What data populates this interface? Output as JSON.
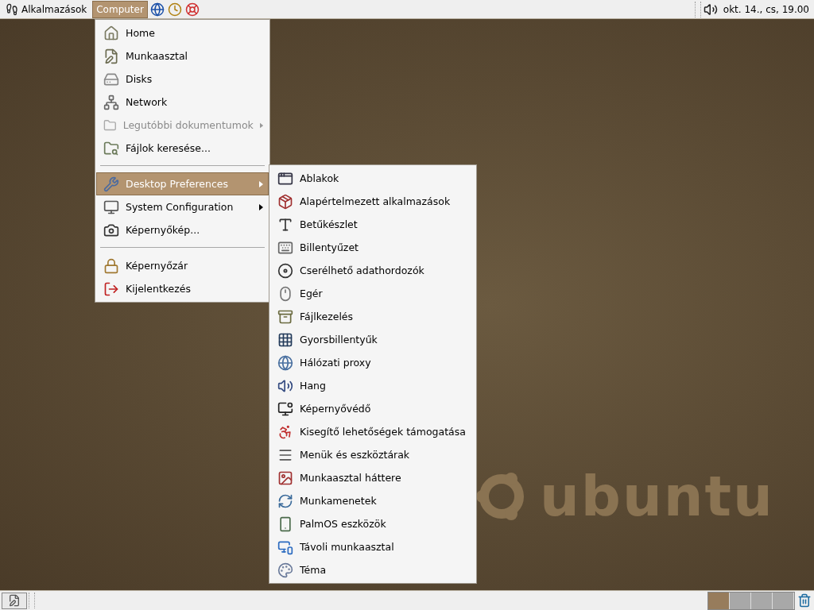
{
  "top_panel": {
    "menus": [
      {
        "label": "Alkalmazások",
        "selected": false
      },
      {
        "label": "Computer",
        "selected": true
      }
    ],
    "clock": "okt. 14., cs, 19.00"
  },
  "computer_menu": [
    {
      "kind": "item",
      "label": "Home",
      "disabled": false,
      "submenu": false,
      "selected": false
    },
    {
      "kind": "item",
      "label": "Munkaasztal",
      "disabled": false,
      "submenu": false,
      "selected": false
    },
    {
      "kind": "item",
      "label": "Disks",
      "disabled": false,
      "submenu": false,
      "selected": false
    },
    {
      "kind": "item",
      "label": "Network",
      "disabled": false,
      "submenu": false,
      "selected": false
    },
    {
      "kind": "item",
      "label": "Legutóbbi dokumentumok",
      "disabled": true,
      "submenu": true,
      "selected": false
    },
    {
      "kind": "item",
      "label": "Fájlok keresése...",
      "disabled": false,
      "submenu": false,
      "selected": false
    },
    {
      "kind": "separator"
    },
    {
      "kind": "item",
      "label": "Desktop Preferences",
      "disabled": false,
      "submenu": true,
      "selected": true
    },
    {
      "kind": "item",
      "label": "System Configuration",
      "disabled": false,
      "submenu": true,
      "selected": false
    },
    {
      "kind": "item",
      "label": "Képernyőkép...",
      "disabled": false,
      "submenu": false,
      "selected": false
    },
    {
      "kind": "separator"
    },
    {
      "kind": "item",
      "label": "Képernyőzár",
      "disabled": false,
      "submenu": false,
      "selected": false
    },
    {
      "kind": "item",
      "label": "Kijelentkezés",
      "disabled": false,
      "submenu": false,
      "selected": false
    }
  ],
  "preferences_submenu": [
    "Ablakok",
    "Alapértelmezett alkalmazások",
    "Betűkészlet",
    "Billentyűzet",
    "Cserélhető adathordozók",
    "Egér",
    "Fájlkezelés",
    "Gyorsbillentyűk",
    "Hálózati proxy",
    "Hang",
    "Képernyővédő",
    "Kisegítő lehetőségek támogatása",
    "Menük és eszköztárak",
    "Munkaasztal háttere",
    "Munkamenetek",
    "PalmOS eszközök",
    "Távoli munkaasztal",
    "Téma"
  ],
  "wallpaper": {
    "logo_text": "ubuntu"
  },
  "bottom_panel": {
    "workspaces": [
      {
        "selected": true
      },
      {
        "selected": false
      },
      {
        "selected": false
      },
      {
        "selected": false
      }
    ]
  }
}
